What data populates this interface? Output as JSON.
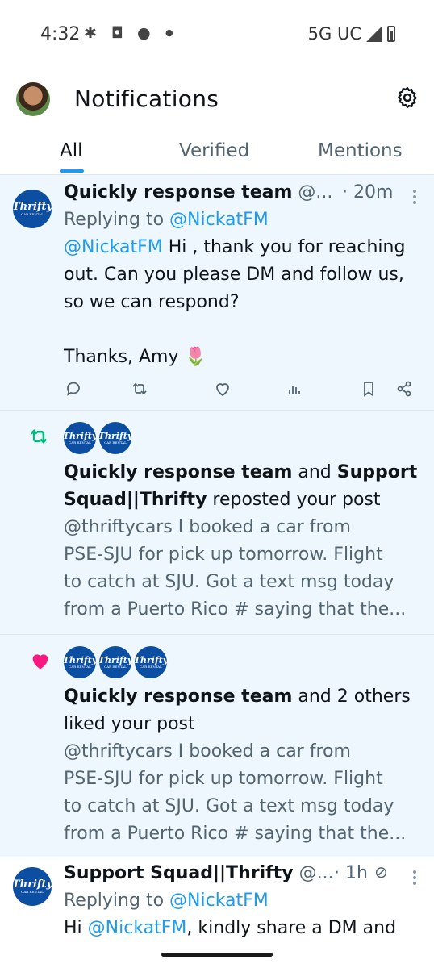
{
  "status_bar": {
    "time": "4:32",
    "network": "5G UC"
  },
  "header": {
    "title": "Notifications"
  },
  "tabs": [
    {
      "label": "All",
      "active": true
    },
    {
      "label": "Verified",
      "active": false
    },
    {
      "label": "Mentions",
      "active": false
    }
  ],
  "notifications": [
    {
      "type": "reply",
      "author": "Quickly response team",
      "handle": "@...",
      "time": "· 20m",
      "replying_prefix": "Replying to ",
      "replying_to": "@NickatFM",
      "mention": "@NickatFM",
      "body_line1": " Hi , thank you for reaching",
      "body_line2": "out. Can you please DM and follow us,",
      "body_line3": "so we can respond?",
      "body_line5": "Thanks, Amy 🌷"
    },
    {
      "type": "repost",
      "actor1": "Quickly response team",
      "connector": " and ",
      "actor2_line1": "Support",
      "actor2_line2": "Squad||Thrifty",
      "action": " reposted your post",
      "preview_line1": "@thriftycars I booked a car from",
      "preview_line2": "PSE-SJU for pick up tomorrow. Flight",
      "preview_line3": "to catch at SJU. Got a text msg today",
      "preview_line4": "from a Puerto Rico # saying that the..."
    },
    {
      "type": "like",
      "actor1": "Quickly response team",
      "rest": " and 2 others",
      "action": "liked your post",
      "preview_line1": "@thriftycars I booked a car from",
      "preview_line2": "PSE-SJU for pick up tomorrow. Flight",
      "preview_line3": "to catch at SJU. Got a text msg today",
      "preview_line4": "from a Puerto Rico # saying that the..."
    },
    {
      "type": "reply",
      "author": "Support Squad||Thrifty",
      "handle": "@...",
      "time": "· 1h",
      "replying_prefix": "Replying to ",
      "replying_to": "@NickatFM",
      "body_pre": "Hi ",
      "mention": "@NickatFM",
      "body_post": ", kindly share a DM and"
    }
  ],
  "brand": {
    "logo_text": "Thrifty",
    "logo_sub": "CAR RENTAL"
  },
  "colors": {
    "accent": "#1d9bf0",
    "repost": "#00ba7c",
    "like": "#f91880",
    "brand": "#0b4ea2"
  }
}
